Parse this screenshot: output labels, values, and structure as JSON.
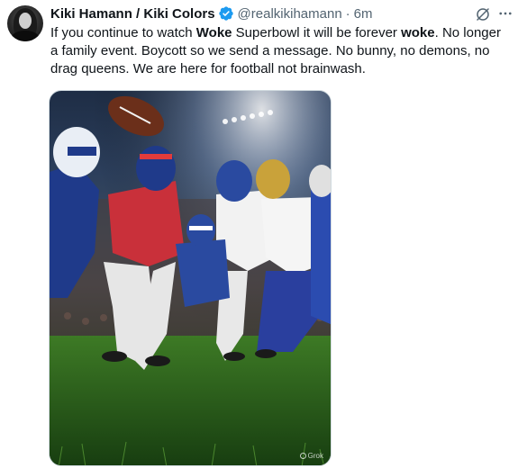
{
  "tweet": {
    "display_name": "Kiki Hamann / Kiki Colors",
    "handle": "@realkikihamann",
    "separator": "·",
    "time": "6m",
    "verified": true,
    "text_segments": [
      {
        "t": "If you continue to watch ",
        "b": false
      },
      {
        "t": "Woke",
        "b": true
      },
      {
        "t": " Superbowl it will be forever ",
        "b": false
      },
      {
        "t": "woke",
        "b": true
      },
      {
        "t": ". No longer a family event. Boycott so we send a message. No bunny, no demons, no drag queens. We are here for football not brainwash.",
        "b": false
      }
    ]
  },
  "media": {
    "alt_description": "AI-generated image of football players in red, white and blue uniforms scrambling for a football in a stadium",
    "watermark": "Grok"
  },
  "colors": {
    "verified_blue": "#1d9bf0",
    "secondary_text": "#536471",
    "primary_text": "#0f1419"
  },
  "icons": [
    "avatar",
    "verified-badge-icon",
    "grok-icon",
    "more-icon"
  ]
}
